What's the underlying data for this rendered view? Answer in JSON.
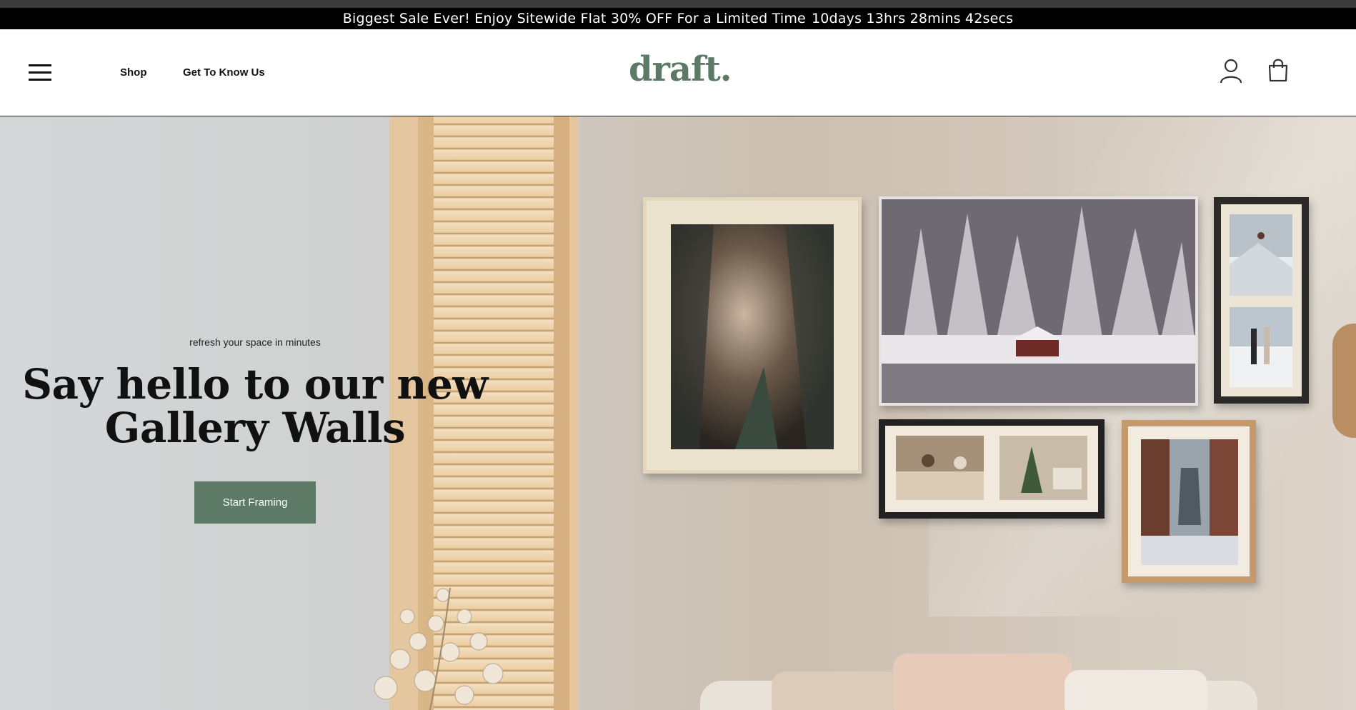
{
  "announcement": {
    "text": "Biggest Sale Ever! Enjoy Sitewide Flat 30% OFF For a Limited Time",
    "countdown": "10days 13hrs 28mins 42secs"
  },
  "header": {
    "logo": "draft.",
    "nav": [
      {
        "label": "Shop"
      },
      {
        "label": "Get To Know Us"
      }
    ],
    "icons": [
      "menu-icon",
      "account-icon",
      "cart-icon"
    ]
  },
  "hero": {
    "tagline": "refresh your space in minutes",
    "headline_line1": "Say hello to our new",
    "headline_line2": "Gallery Walls",
    "cta_label": "Start Framing"
  },
  "colors": {
    "brand": "#5d7a66",
    "announcement_bg": "#000000",
    "text": "#111111"
  }
}
